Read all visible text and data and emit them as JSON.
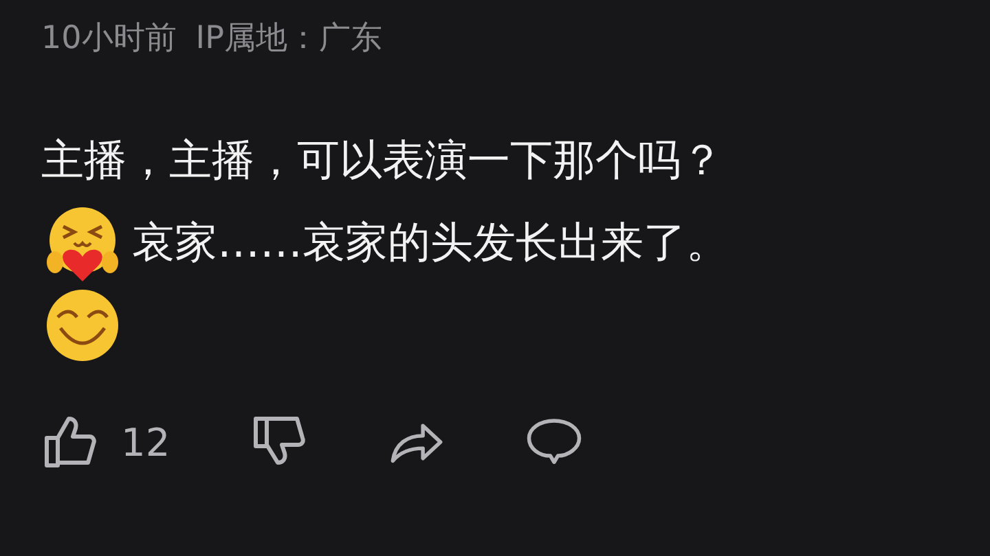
{
  "meta": {
    "time": "10小时前",
    "ip": "IP属地：广东"
  },
  "lines": [
    [
      {
        "kind": "text",
        "text": "主播，主播，可以表演一下那个吗？"
      }
    ],
    [
      {
        "kind": "hug"
      },
      {
        "kind": "text",
        "text": "哀家……哀家的头发长出来了。"
      }
    ],
    [
      {
        "kind": "grin"
      }
    ]
  ],
  "actions": {
    "like_count": "12"
  }
}
